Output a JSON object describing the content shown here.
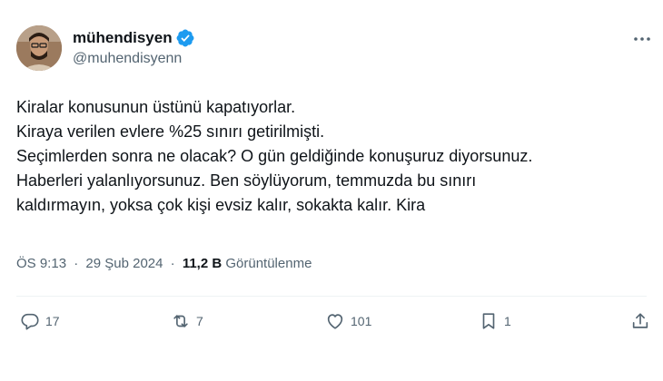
{
  "author": {
    "display_name": "mühendisyen",
    "handle": "@muhendisyenn",
    "verified": true
  },
  "body_lines": [
    "Kiralar konusunun üstünü kapatıyorlar.",
    "Kiraya verilen evlere %25 sınırı getirilmişti.",
    "Seçimlerden sonra ne olacak? O gün geldiğinde konuşuruz diyorsunuz.",
    "Haberleri yalanlıyorsunuz. Ben söylüyorum, temmuzda bu sınırı",
    "kaldırmayın, yoksa çok kişi evsiz kalır, sokakta kalır. Kira"
  ],
  "meta": {
    "time": "ÖS 9:13",
    "separator": "·",
    "date": "29 Şub 2024",
    "views_count": "11,2 B",
    "views_label": "Görüntülenme"
  },
  "actions": {
    "replies": "17",
    "reposts": "7",
    "likes": "101",
    "bookmarks": "1"
  },
  "icons": [
    "more-icon",
    "verified-badge-icon",
    "reply-icon",
    "repost-icon",
    "like-icon",
    "bookmark-icon",
    "share-icon"
  ],
  "colors": {
    "text_primary": "#0f1419",
    "text_secondary": "#536471",
    "verified_blue": "#1d9bf0",
    "divider": "#eff3f4"
  }
}
